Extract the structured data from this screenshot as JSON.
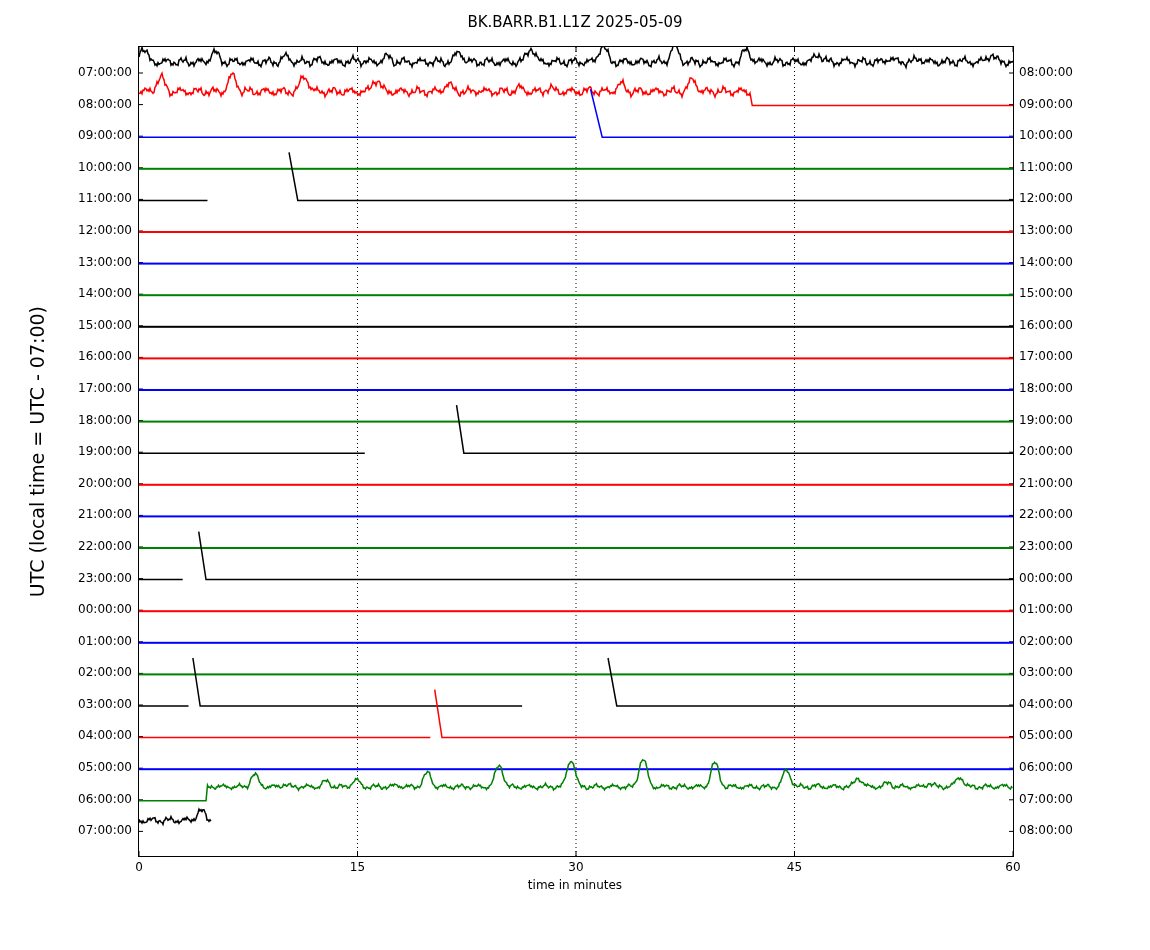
{
  "title": "BK.BARR.B1.L1Z 2025-05-09",
  "ylabel": "UTC (local time = UTC - 07:00)",
  "xlabel": "time in minutes",
  "xticks": [
    "0",
    "15",
    "30",
    "45",
    "60"
  ],
  "rows": [
    {
      "left": "07:00:00",
      "right": "08:00:00",
      "color": "#000000",
      "kind": "noisy"
    },
    {
      "left": "08:00:00",
      "right": "09:00:00",
      "color": "#ff0000",
      "kind": "noisy-flat"
    },
    {
      "left": "09:00:00",
      "right": "10:00:00",
      "color": "#0000ff",
      "kind": "step"
    },
    {
      "left": "10:00:00",
      "right": "11:00:00",
      "color": "#008000",
      "kind": "flat"
    },
    {
      "left": "11:00:00",
      "right": "12:00:00",
      "color": "#000000",
      "kind": "step"
    },
    {
      "left": "12:00:00",
      "right": "13:00:00",
      "color": "#ff0000",
      "kind": "flat"
    },
    {
      "left": "13:00:00",
      "right": "14:00:00",
      "color": "#0000ff",
      "kind": "flat"
    },
    {
      "left": "14:00:00",
      "right": "15:00:00",
      "color": "#008000",
      "kind": "flat"
    },
    {
      "left": "15:00:00",
      "right": "16:00:00",
      "color": "#000000",
      "kind": "flat"
    },
    {
      "left": "16:00:00",
      "right": "17:00:00",
      "color": "#ff0000",
      "kind": "flat"
    },
    {
      "left": "17:00:00",
      "right": "18:00:00",
      "color": "#0000ff",
      "kind": "flat"
    },
    {
      "left": "18:00:00",
      "right": "19:00:00",
      "color": "#008000",
      "kind": "flat"
    },
    {
      "left": "19:00:00",
      "right": "20:00:00",
      "color": "#000000",
      "kind": "step"
    },
    {
      "left": "20:00:00",
      "right": "21:00:00",
      "color": "#ff0000",
      "kind": "flat"
    },
    {
      "left": "21:00:00",
      "right": "22:00:00",
      "color": "#0000ff",
      "kind": "flat"
    },
    {
      "left": "22:00:00",
      "right": "23:00:00",
      "color": "#008000",
      "kind": "flat"
    },
    {
      "left": "23:00:00",
      "right": "00:00:00",
      "color": "#000000",
      "kind": "step"
    },
    {
      "left": "00:00:00",
      "right": "01:00:00",
      "color": "#ff0000",
      "kind": "flat"
    },
    {
      "left": "01:00:00",
      "right": "02:00:00",
      "color": "#0000ff",
      "kind": "flat"
    },
    {
      "left": "02:00:00",
      "right": "03:00:00",
      "color": "#008000",
      "kind": "flat"
    },
    {
      "left": "03:00:00",
      "right": "04:00:00",
      "color": "#000000",
      "kind": "step"
    },
    {
      "left": "04:00:00",
      "right": "05:00:00",
      "color": "#ff0000",
      "kind": "step"
    },
    {
      "left": "05:00:00",
      "right": "06:00:00",
      "color": "#0000ff",
      "kind": "flat"
    },
    {
      "left": "06:00:00",
      "right": "07:00:00",
      "color": "#008000",
      "kind": "flat-noisy"
    },
    {
      "left": "07:00:00",
      "right": "08:00:00",
      "color": "#000000",
      "kind": "noisy-short"
    }
  ]
}
